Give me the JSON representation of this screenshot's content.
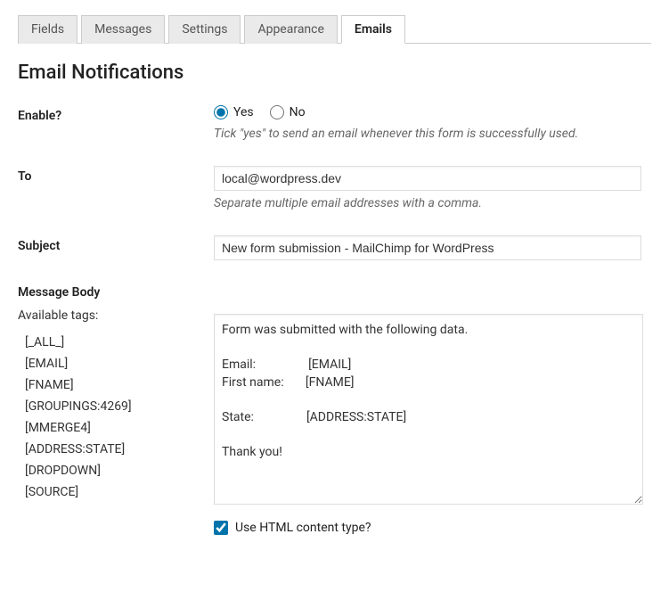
{
  "tabs": {
    "fields": "Fields",
    "messages": "Messages",
    "settings": "Settings",
    "appearance": "Appearance",
    "emails": "Emails"
  },
  "heading": "Email Notifications",
  "enable": {
    "label": "Enable?",
    "yes": "Yes",
    "no": "No",
    "help": "Tick \"yes\" to send an email whenever this form is successfully used."
  },
  "to": {
    "label": "To",
    "value": "local@wordpress.dev",
    "help": "Separate multiple email addresses with a comma."
  },
  "subject": {
    "label": "Subject",
    "value": "New form submission - MailChimp for WordPress"
  },
  "body": {
    "label": "Message Body",
    "tags_label": "Available tags:",
    "tags": {
      "t0": "[_ALL_]",
      "t1": "[EMAIL]",
      "t2": "[FNAME]",
      "t3": "[GROUPINGS:4269]",
      "t4": "[MMERGE4]",
      "t5": "[ADDRESS:STATE]",
      "t6": "[DROPDOWN]",
      "t7": "[SOURCE]"
    },
    "content": "Form was submitted with the following data.\n\nEmail:                 [EMAIL]\nFirst name:       [FNAME]\n\nState:                 [ADDRESS:STATE]\n\nThank you!"
  },
  "html_content": {
    "label": "Use HTML content type?"
  }
}
